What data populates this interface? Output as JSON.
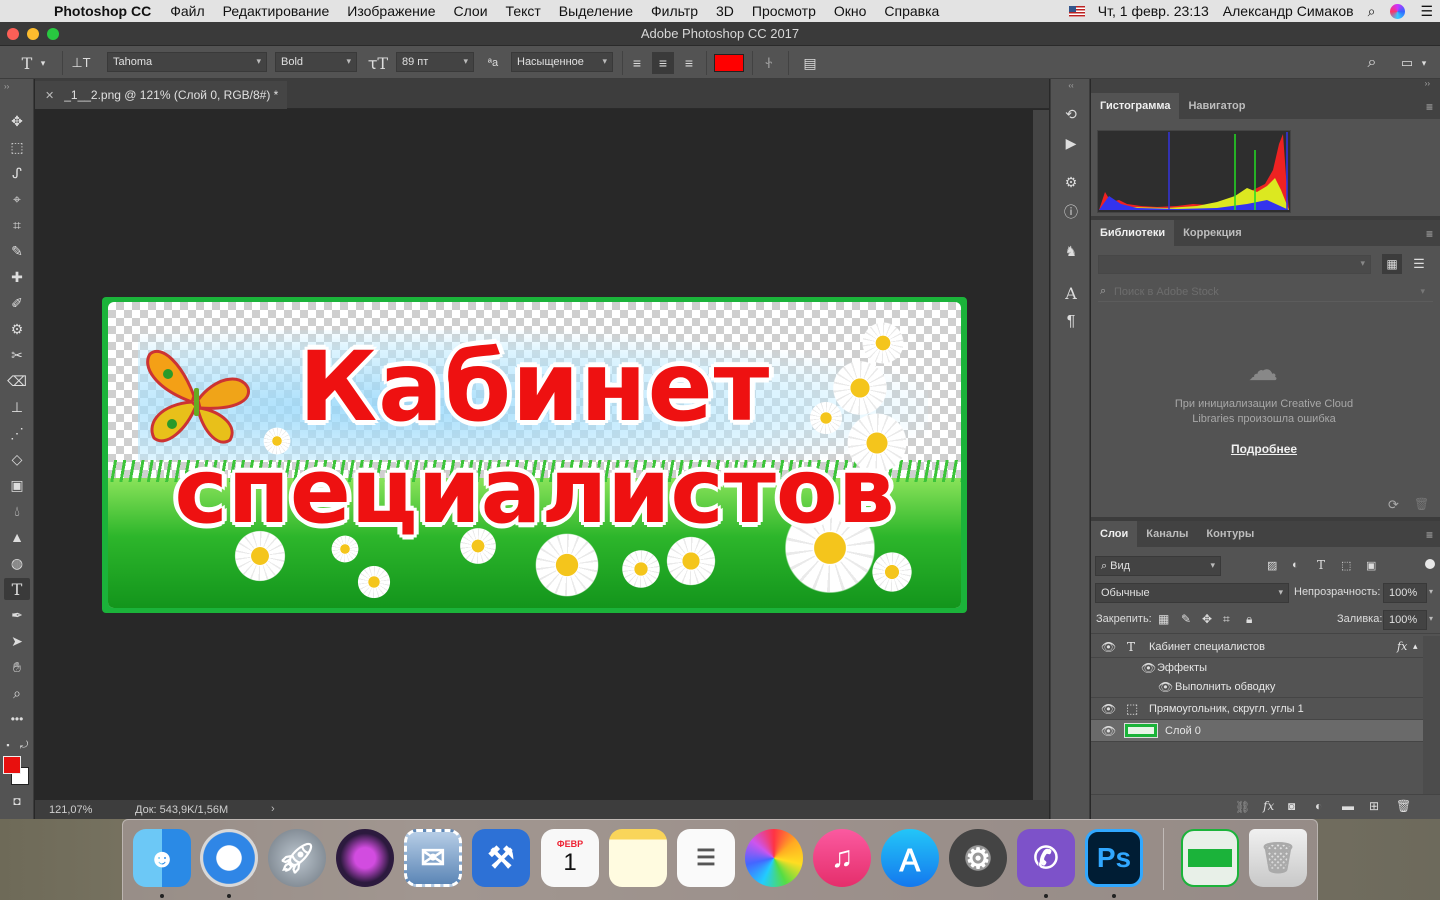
{
  "menubar": {
    "app_name": "Photoshop CC",
    "items": [
      "Файл",
      "Редактирование",
      "Изображение",
      "Слои",
      "Текст",
      "Выделение",
      "Фильтр",
      "3D",
      "Просмотр",
      "Окно",
      "Справка"
    ],
    "datetime": "Чт, 1 февр.  23:13",
    "user": "Александр Симаков"
  },
  "window": {
    "title": "Adobe Photoshop CC 2017"
  },
  "options": {
    "font_family": "Tahoma",
    "font_style": "Bold",
    "font_size": "89 пт",
    "antialias": "Насыщенное",
    "text_color": "#ff0000"
  },
  "document": {
    "tab_title": "_1__2.png @ 121% (Слой 0, RGB/8#) *",
    "zoom": "121,07%",
    "doc_info": "Док: 543,9K/1,56M",
    "line1": "Кабинет",
    "line2": "специалистов"
  },
  "panels": {
    "histogram_tabs": [
      "Гистограмма",
      "Навигатор"
    ],
    "libraries_tabs": [
      "Библиотеки",
      "Коррекция"
    ],
    "stock_search_placeholder": "Поиск в Adobe Stock",
    "library_error": "При инициализации Creative Cloud Libraries произошла ошибка",
    "more_link": "Подробнее",
    "layers_tabs": [
      "Слои",
      "Каналы",
      "Контуры"
    ],
    "filter_kind": "Вид",
    "blend_mode": "Обычные",
    "opacity_label": "Непрозрачность:",
    "opacity_value": "100%",
    "lock_label": "Закрепить:",
    "fill_label": "Заливка:",
    "fill_value": "100%",
    "layers": {
      "text_layer": "Кабинет специалистов",
      "effects": "Эффекты",
      "stroke": "Выполнить обводку",
      "shape_layer": "Прямоугольник, скругл. углы 1",
      "base_layer": "Слой 0"
    }
  },
  "dock": {
    "calendar_month": "ФЕВР",
    "calendar_day": "1",
    "ps_label": "Ps"
  }
}
